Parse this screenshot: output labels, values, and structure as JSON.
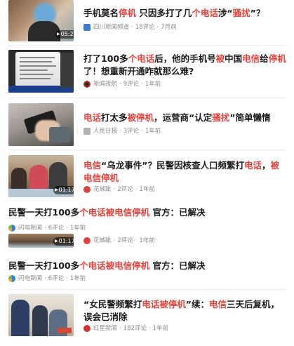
{
  "items": [
    {
      "title": [
        {
          "t": "手机莫名",
          "hl": false
        },
        {
          "t": "停机",
          "hl": true
        },
        {
          "t": " 只因多打了几",
          "hl": false
        },
        {
          "t": "个电话",
          "hl": true
        },
        {
          "t": "涉“",
          "hl": false
        },
        {
          "t": "骚扰",
          "hl": true
        },
        {
          "t": "”？",
          "hl": false
        }
      ],
      "source": "四川新闻频道",
      "comments": "18评论",
      "time": "7月前",
      "duration": "05:24",
      "icon": "sichuan-news-logo-icon",
      "icon_color": "#3a7bd5"
    },
    {
      "title": [
        {
          "t": "打了100多",
          "hl": false
        },
        {
          "t": "个电话",
          "hl": true
        },
        {
          "t": "后，他的手机号",
          "hl": false
        },
        {
          "t": "被",
          "hl": true
        },
        {
          "t": "中国",
          "hl": false
        },
        {
          "t": "电信",
          "hl": true
        },
        {
          "t": "给",
          "hl": false
        },
        {
          "t": "停机",
          "hl": true
        },
        {
          "t": "了！想重新开通咋就那么难?",
          "hl": false
        }
      ],
      "source": "新闻夜航",
      "comments": "9评论",
      "time": "1年前",
      "icon": "news-night-logo-icon",
      "icon_color": "#b7321f"
    },
    {
      "title": [
        {
          "t": "电话",
          "hl": true
        },
        {
          "t": "打太多",
          "hl": false
        },
        {
          "t": "被停机",
          "hl": true
        },
        {
          "t": "，运营商“认定",
          "hl": false
        },
        {
          "t": "骚扰",
          "hl": true
        },
        {
          "t": "”简单懒惰",
          "hl": false
        }
      ],
      "source": "人民日报",
      "comments": "3评论",
      "time": "1年前",
      "icon": "peoples-daily-logo-icon",
      "icon_color": "#b0b0b0"
    },
    {
      "title": [
        {
          "t": "电信",
          "hl": true
        },
        {
          "t": "“乌龙事件”？民警因核查人口频繁打",
          "hl": false
        },
        {
          "t": "电话",
          "hl": true
        },
        {
          "t": "，",
          "hl": false
        },
        {
          "t": "被电信停机",
          "hl": true
        }
      ],
      "source": "花城眦",
      "comments": "2评论",
      "time": "1年前",
      "duration": "01:17",
      "icon": "huacheng-logo-icon",
      "icon_color": "#d9433a"
    },
    {
      "title": [
        {
          "t": "民警一天打100多",
          "hl": false
        },
        {
          "t": "个电话被电信停机",
          "hl": true
        },
        {
          "t": " 官方：已解决",
          "hl": false
        }
      ],
      "source": "闪电新闻",
      "comments": "6评论",
      "time": "1年前",
      "icon": "lightning-news-logo-icon",
      "icon_color": "#2f7fe0"
    },
    {
      "title": [],
      "source": "花城眦",
      "comments": "2评论",
      "time": "1年前",
      "duration": "01:17",
      "icon": "huacheng-logo-icon",
      "icon_color": "#d9433a"
    },
    {
      "title": [
        {
          "t": "民警一天打100多",
          "hl": false
        },
        {
          "t": "个电话被电信停机",
          "hl": true
        },
        {
          "t": " 官方：已解决",
          "hl": false
        }
      ],
      "source": "闪电新闻",
      "comments": "6评论",
      "time": "1年前",
      "icon": "lightning-news-logo-icon",
      "icon_color": "#2f7fe0"
    },
    {
      "title": [
        {
          "t": "“女民警频繁打",
          "hl": false
        },
        {
          "t": "电话被停机",
          "hl": true
        },
        {
          "t": "”续：",
          "hl": false
        },
        {
          "t": "电信",
          "hl": true
        },
        {
          "t": "三天后复机，误会已消除",
          "hl": false
        }
      ],
      "source": "红星新闻",
      "comments": "182评论",
      "time": "1年前",
      "icon": "red-star-news-logo-icon",
      "icon_color": "#d6332b"
    }
  ],
  "highlight_color": "#e8413b"
}
